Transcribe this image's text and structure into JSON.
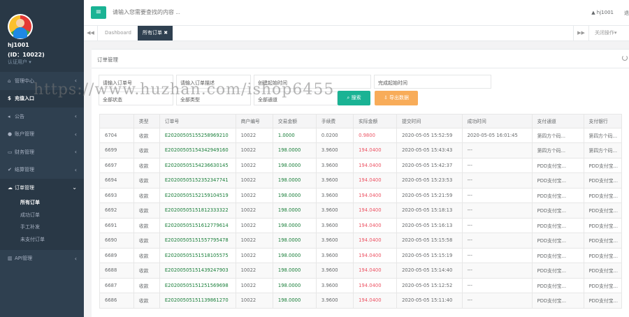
{
  "sidebar": {
    "username": "hj1001",
    "user_id": "(ID：10022)",
    "role": "认证用户 ▾",
    "items": [
      {
        "label": "管理中心",
        "icon": "home-icon",
        "arrow": "‹"
      },
      {
        "label": "充值入口",
        "icon": "dollar-icon",
        "arrow": ""
      },
      {
        "label": "公告",
        "icon": "bullhorn-icon",
        "arrow": "‹"
      },
      {
        "label": "账户管理",
        "icon": "user-icon",
        "arrow": "‹"
      },
      {
        "label": "财务管理",
        "icon": "money-icon",
        "arrow": "‹"
      },
      {
        "label": "结算管理",
        "icon": "check-icon",
        "arrow": "‹"
      },
      {
        "label": "订单管理",
        "icon": "cloud-icon",
        "arrow": "⌄"
      },
      {
        "label": "API管理",
        "icon": "bank-icon",
        "arrow": "‹"
      }
    ],
    "subitems": [
      "所有订单",
      "成功订单",
      "手工补发",
      "未支付订单"
    ]
  },
  "topbar": {
    "menu_icon": "menu-icon",
    "search_placeholder": "请输入您需要查找的内容 ...",
    "user": "hj1001",
    "cut_text": "退"
  },
  "tabs": {
    "dashboard": "Dashboard",
    "current": "所有订单 ✖",
    "close_ops": "关闭操作▾"
  },
  "panel": {
    "title": "订单管理",
    "filters": {
      "order_no": "请输入订单号",
      "order_desc": "请输入订单描述",
      "create_time": "创建起始时间",
      "complete_time": "完成起始时间",
      "status": "全部状态",
      "type": "全部类型",
      "channel": "全部通道"
    },
    "search_btn": "搜索",
    "export_btn": "导出数据"
  },
  "watermark": "https://www.huzhan.com/ishop6455",
  "table": {
    "headers": [
      "",
      "类型",
      "订单号",
      "商户编号",
      "交易金额",
      "手续费",
      "实际金额",
      "提交时间",
      "成功时间",
      "支付通道",
      "支付银行"
    ],
    "rows": [
      [
        "6704",
        "收款",
        "E20200505155258969210",
        "10022",
        "1.0000",
        "0.0200",
        "0.9800",
        "2020-05-05 15:52:59",
        "2020-05-05 16:01:45",
        "第四方个码...",
        "第四方个码..."
      ],
      [
        "6699",
        "收款",
        "E20200505154342949160",
        "10022",
        "198.0000",
        "3.9600",
        "194.0400",
        "2020-05-05 15:43:43",
        "---",
        "第四方个码...",
        "第四方个码..."
      ],
      [
        "6697",
        "收款",
        "E20200505154236630145",
        "10022",
        "198.0000",
        "3.9600",
        "194.0400",
        "2020-05-05 15:42:37",
        "---",
        "PDD支付宝...",
        "PDD支付宝..."
      ],
      [
        "6694",
        "收款",
        "E20200505152352347741",
        "10022",
        "198.0000",
        "3.9600",
        "194.0400",
        "2020-05-05 15:23:53",
        "---",
        "PDD支付宝...",
        "PDD支付宝..."
      ],
      [
        "6693",
        "收款",
        "E20200505152159104519",
        "10022",
        "198.0000",
        "3.9600",
        "194.0400",
        "2020-05-05 15:21:59",
        "---",
        "PDD支付宝...",
        "PDD支付宝..."
      ],
      [
        "6692",
        "收款",
        "E20200505151812333322",
        "10022",
        "198.0000",
        "3.9600",
        "194.0400",
        "2020-05-05 15:18:13",
        "---",
        "PDD支付宝...",
        "PDD支付宝..."
      ],
      [
        "6691",
        "收款",
        "E20200505151612779614",
        "10022",
        "198.0000",
        "3.9600",
        "194.0400",
        "2020-05-05 15:16:13",
        "---",
        "PDD支付宝...",
        "PDD支付宝..."
      ],
      [
        "6690",
        "收款",
        "E20200505151557795478",
        "10022",
        "198.0000",
        "3.9600",
        "194.0400",
        "2020-05-05 15:15:58",
        "---",
        "PDD支付宝...",
        "PDD支付宝..."
      ],
      [
        "6689",
        "收款",
        "E20200505151518105575",
        "10022",
        "198.0000",
        "3.9600",
        "194.0400",
        "2020-05-05 15:15:19",
        "---",
        "PDD支付宝...",
        "PDD支付宝..."
      ],
      [
        "6688",
        "收款",
        "E20200505151439247903",
        "10022",
        "198.0000",
        "3.9600",
        "194.0400",
        "2020-05-05 15:14:40",
        "---",
        "PDD支付宝...",
        "PDD支付宝..."
      ],
      [
        "6687",
        "收款",
        "E20200505151251569698",
        "10022",
        "198.0000",
        "3.9600",
        "194.0400",
        "2020-05-05 15:12:52",
        "---",
        "PDD支付宝...",
        "PDD支付宝..."
      ],
      [
        "6686",
        "收款",
        "E20200505151139861270",
        "10022",
        "198.0000",
        "3.9600",
        "194.0400",
        "2020-05-05 15:11:40",
        "---",
        "PDD支付宝...",
        "PDD支付宝..."
      ]
    ]
  }
}
